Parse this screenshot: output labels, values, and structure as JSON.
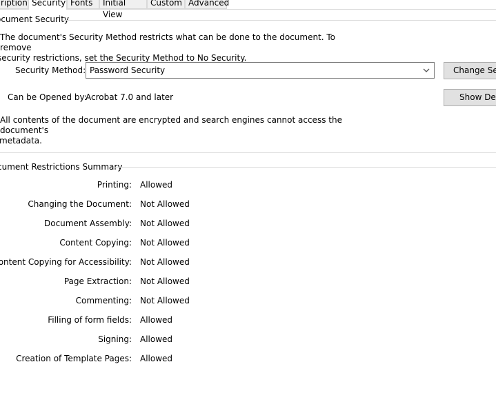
{
  "tabs": [
    "ription",
    "Security",
    "Fonts",
    "Initial View",
    "Custom",
    "Advanced"
  ],
  "document_security": {
    "title": "ocument Security",
    "description_line1": "The document's Security Method restricts what can be done to the document. To remove",
    "description_line2": "security restrictions, set the Security Method to No Security.",
    "method_label": "Security Method:",
    "method_value": "Password Security",
    "change_button": "Change Settings...",
    "opened_label": "Can be Opened by:",
    "opened_value": "Acrobat 7.0 and later",
    "details_button": "Show Details...",
    "encryption_line1": "All contents of the document are encrypted and search engines cannot access the document's",
    "encryption_line2": "metadata."
  },
  "restrictions": {
    "title": "cument Restrictions Summary",
    "rows": [
      {
        "label": "Printing:",
        "value": "Allowed"
      },
      {
        "label": "Changing the Document:",
        "value": "Not Allowed"
      },
      {
        "label": "Document Assembly:",
        "value": "Not Allowed"
      },
      {
        "label": "Content Copying:",
        "value": "Not Allowed"
      },
      {
        "label": "Content Copying for Accessibility:",
        "value": "Not Allowed"
      },
      {
        "label": "Page Extraction:",
        "value": "Not Allowed"
      },
      {
        "label": "Commenting:",
        "value": "Not Allowed"
      },
      {
        "label": "Filling of form fields:",
        "value": "Allowed"
      },
      {
        "label": "Signing:",
        "value": "Allowed"
      },
      {
        "label": "Creation of Template Pages:",
        "value": "Allowed"
      }
    ]
  }
}
